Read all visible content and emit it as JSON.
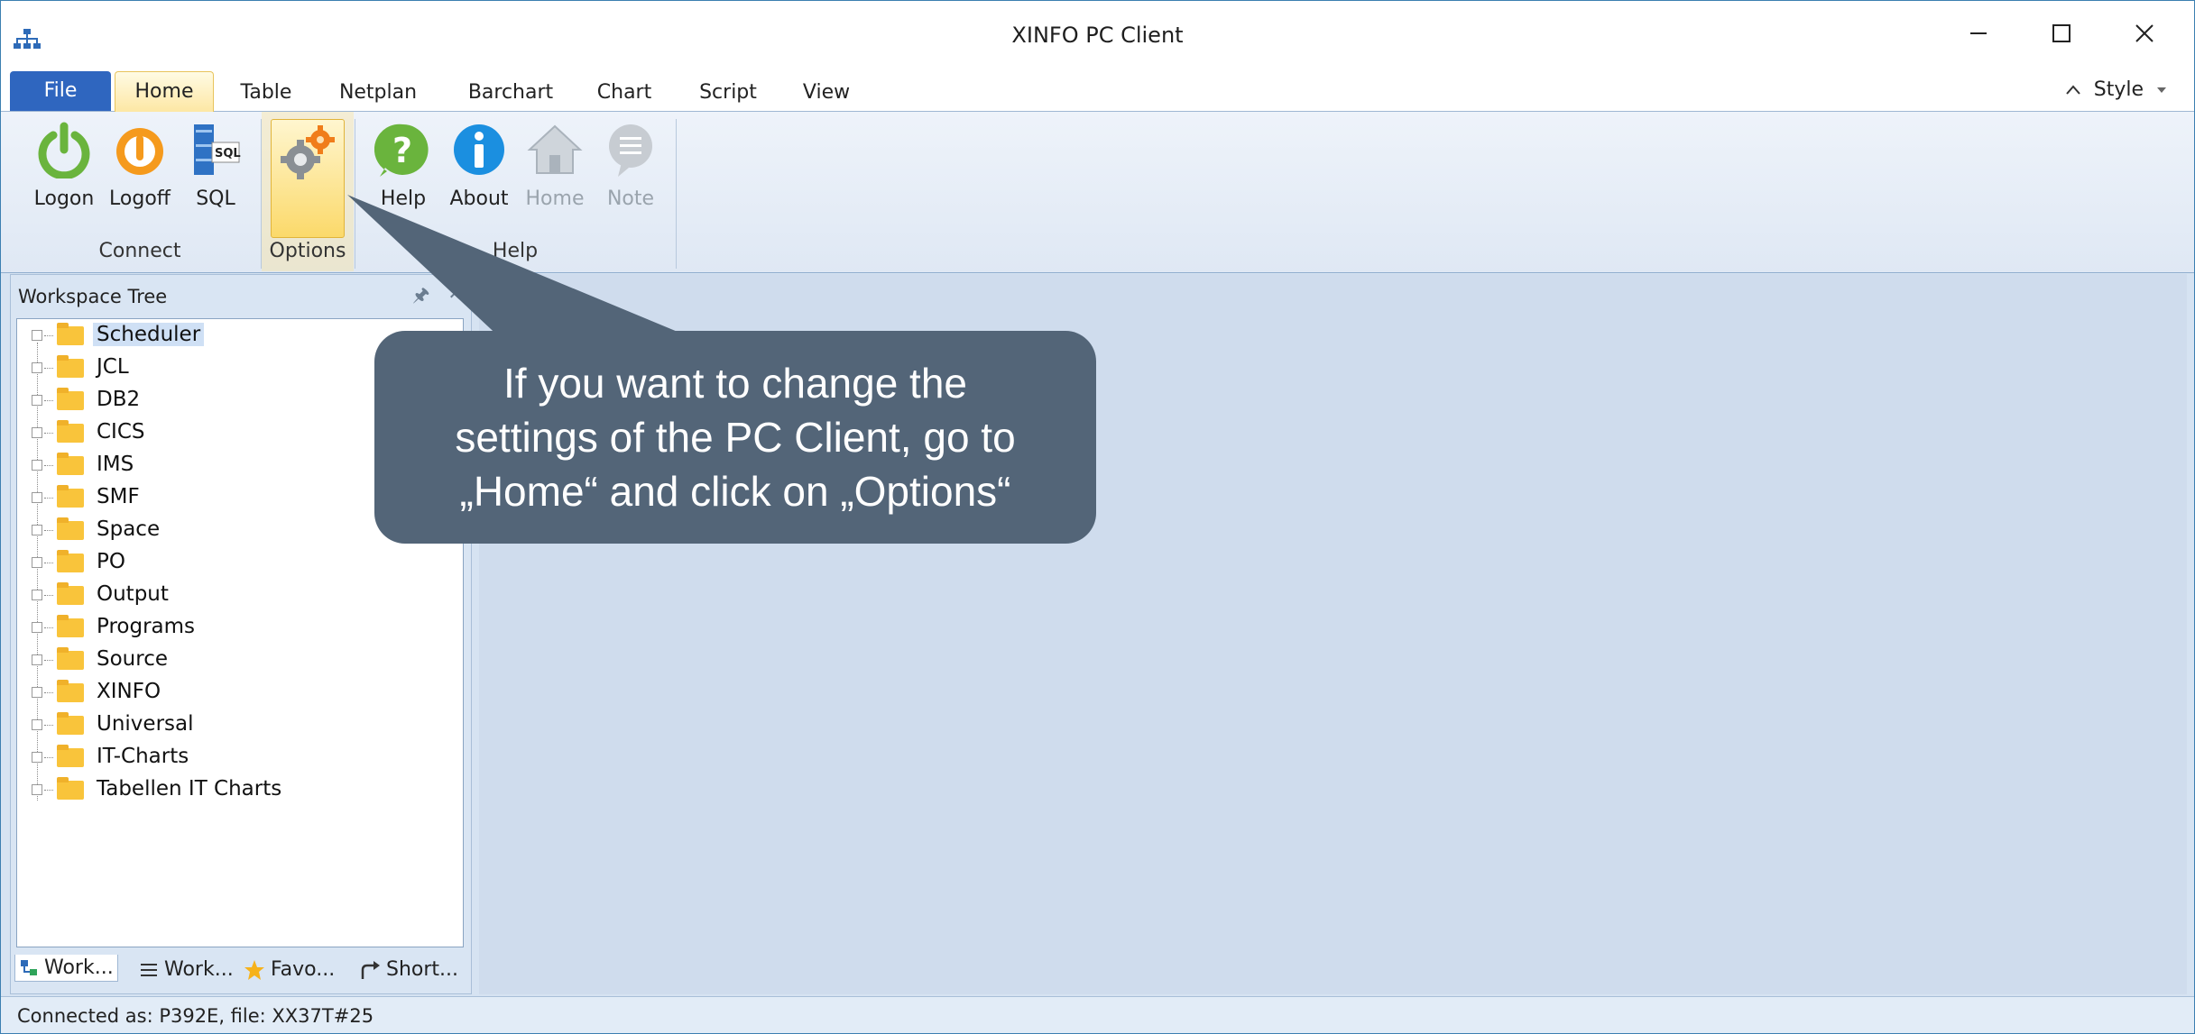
{
  "window": {
    "title": "XINFO PC Client"
  },
  "tabs": [
    "File",
    "Home",
    "Table",
    "Netplan",
    "Barchart",
    "Chart",
    "Script",
    "View"
  ],
  "style_menu": {
    "label": "Style"
  },
  "ribbon": {
    "connect": {
      "logon": "Logon",
      "logoff": "Logoff",
      "sql": "SQL",
      "group": "Connect"
    },
    "options": {
      "group": "Options"
    },
    "help": {
      "help": "Help",
      "about": "About",
      "home": "Home",
      "note": "Note",
      "group": "Help"
    }
  },
  "workspace_tree": {
    "title": "Workspace Tree",
    "items": [
      "Scheduler",
      "JCL",
      "DB2",
      "CICS",
      "IMS",
      "SMF",
      "Space",
      "PO",
      "Output",
      "Programs",
      "Source",
      "XINFO",
      "Universal",
      "IT-Charts",
      "Tabellen IT Charts"
    ],
    "bottom_tabs": [
      "Work...",
      "Work...",
      "Favo...",
      "Short..."
    ]
  },
  "status_bar": {
    "text": "Connected as: P392E, file: XX37T#25"
  },
  "callout": {
    "line1": "If you want to change the",
    "line2": "settings of the PC Client, go to",
    "line3": "„Home“ and click on „Options“"
  },
  "colors": {
    "file_tab": "#2f66bf",
    "callout_bg": "#536578",
    "options_highlight": "#fbd96a"
  }
}
